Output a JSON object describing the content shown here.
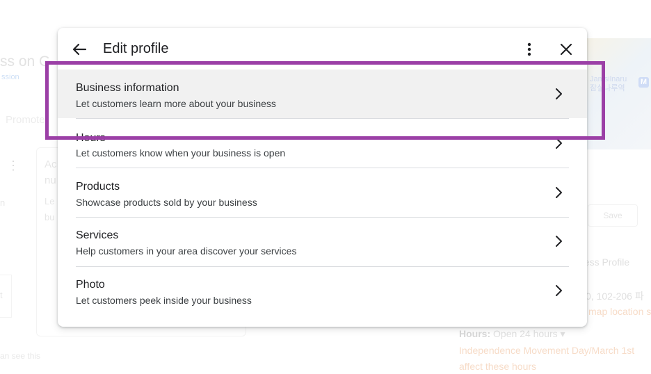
{
  "background": {
    "title_fragment": "ss on G",
    "subtitle_fragment": "ssion",
    "tab_fragment": "Promote",
    "card_text_1": "Ac",
    "card_text_2": "nu",
    "card_text_3": "Le",
    "card_text_4": "bu",
    "left_text": "n",
    "left_box_text": "t",
    "map_label_line1": "Jamsilnaru",
    "map_label_line2": "잠실나루역",
    "map_badge": "M",
    "save_label": "Save",
    "profile_fragment": "ness Profile",
    "address_fragment": "0, 102-206 파",
    "map_location_fragment": "map location s",
    "hours_label": "Hours:",
    "hours_value": "Open 24 hours ▾",
    "holiday_text": "Independence Movement Day/March 1st",
    "affect_text": "affect these hours",
    "see_this_fragment": "an see this"
  },
  "dialog": {
    "title": "Edit profile",
    "icons": {
      "back": "arrow-back-icon",
      "more": "more-vert-icon",
      "close": "close-icon",
      "chevron": "chevron-right-icon"
    },
    "items": [
      {
        "title": "Business information",
        "description": "Let customers learn more about your business"
      },
      {
        "title": "Hours",
        "description": "Let customers know when your business is open"
      },
      {
        "title": "Products",
        "description": "Showcase products sold by your business"
      },
      {
        "title": "Services",
        "description": "Help customers in your area discover your services"
      },
      {
        "title": "Photo",
        "description": "Let customers peek inside your business"
      }
    ]
  },
  "annotation": {
    "color": "#9b3fa6"
  }
}
